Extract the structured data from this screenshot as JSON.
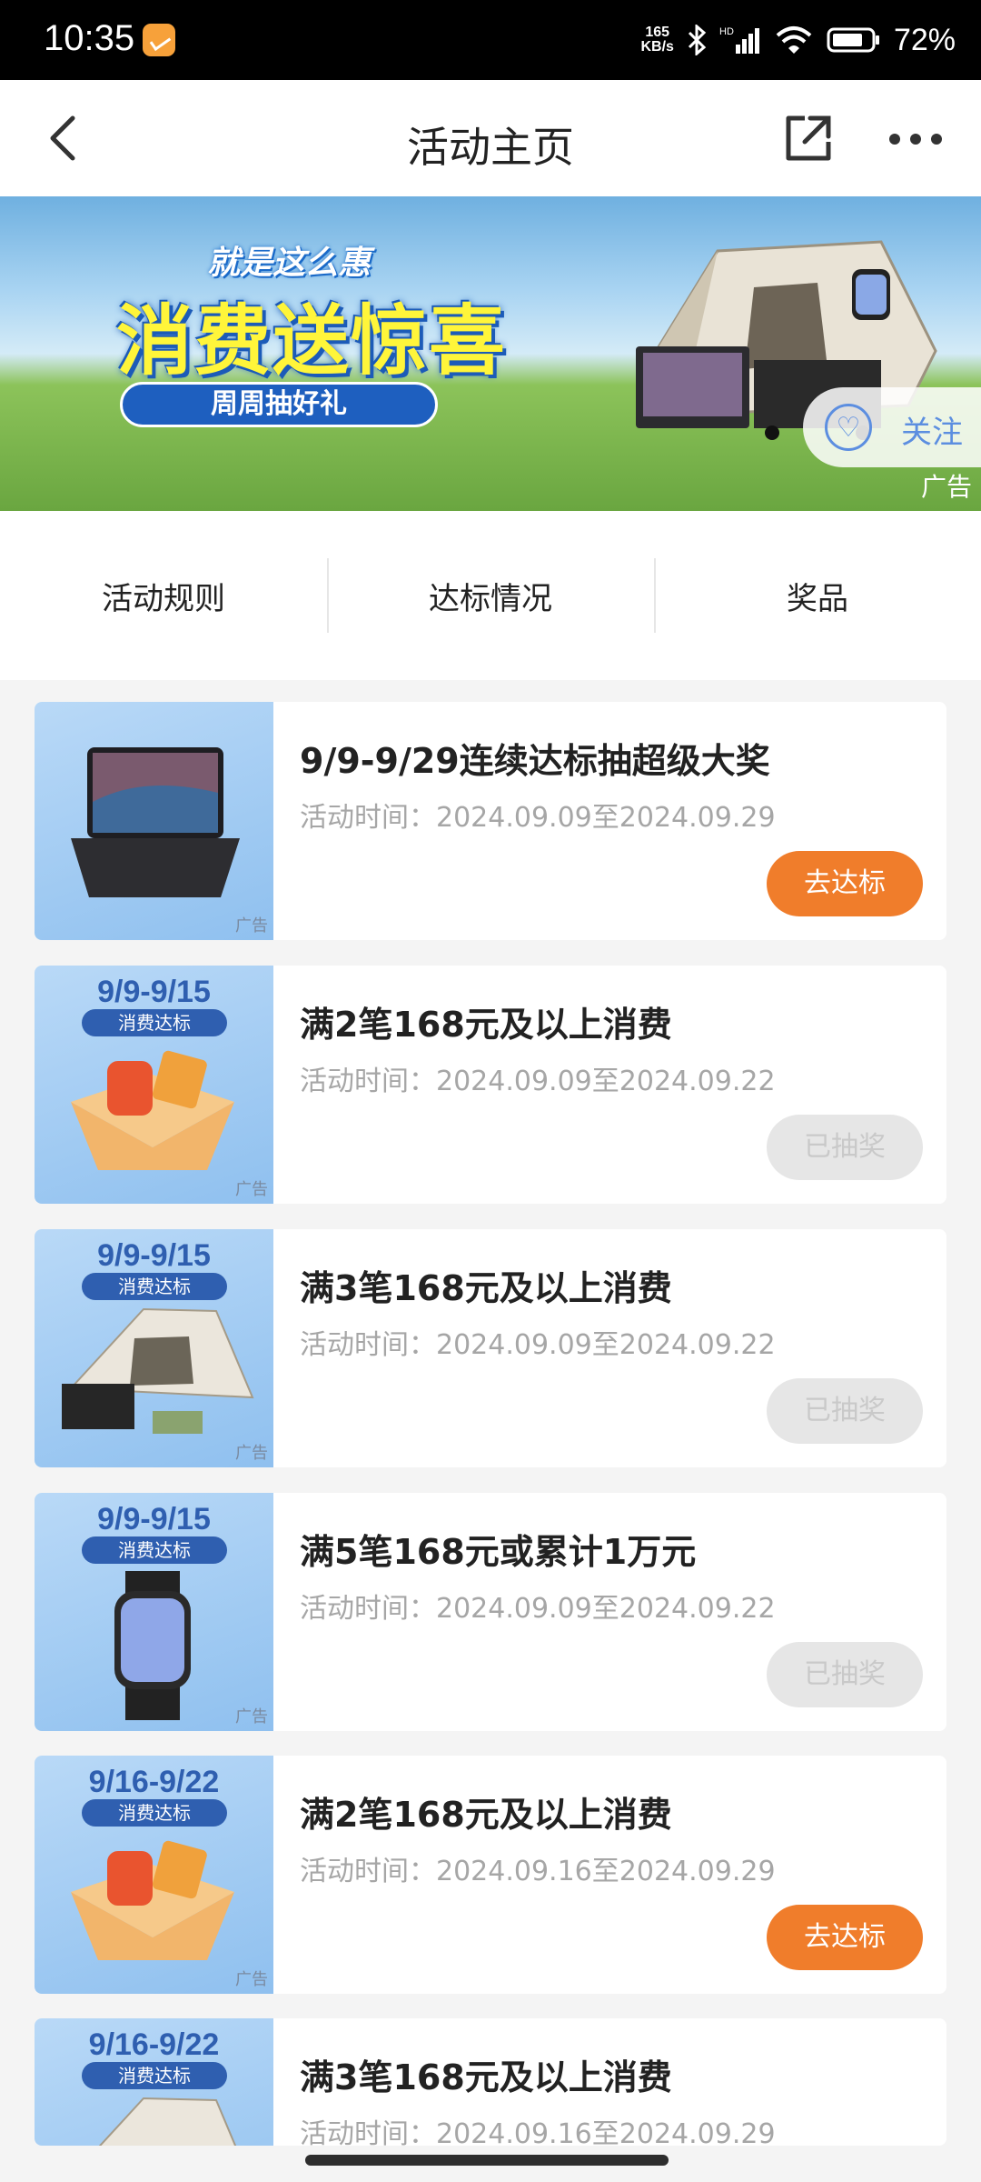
{
  "status_bar": {
    "time": "10:35",
    "net_speed_value": "165",
    "net_speed_unit": "KB/s",
    "hd": "HD",
    "battery": "72%"
  },
  "header": {
    "title": "活动主页"
  },
  "banner": {
    "brand": "就是这么惠",
    "headline": "消费送惊喜",
    "subline": "周周抽好礼",
    "follow_label": "关注",
    "ad_tag": "广告"
  },
  "tabs": [
    {
      "label": "活动规则"
    },
    {
      "label": "达标情况"
    },
    {
      "label": "奖品"
    }
  ],
  "activities": [
    {
      "thumb_date": "",
      "thumb_tag": "",
      "image": "laptop",
      "ad_tag": "广告",
      "title": "9/9-9/29连续达标抽超级大奖",
      "time": "活动时间：2024.09.09至2024.09.29",
      "button": "去达标",
      "state": "active"
    },
    {
      "thumb_date": "9/9-9/15",
      "thumb_tag": "消费达标",
      "image": "gift-box",
      "ad_tag": "广告",
      "title": "满2笔168元及以上消费",
      "time": "活动时间：2024.09.09至2024.09.22",
      "button": "已抽奖",
      "state": "done"
    },
    {
      "thumb_date": "9/9-9/15",
      "thumb_tag": "消费达标",
      "image": "tent",
      "ad_tag": "广告",
      "title": "满3笔168元及以上消费",
      "time": "活动时间：2024.09.09至2024.09.22",
      "button": "已抽奖",
      "state": "done"
    },
    {
      "thumb_date": "9/9-9/15",
      "thumb_tag": "消费达标",
      "image": "smartwatch",
      "ad_tag": "广告",
      "title": "满5笔168元或累计1万元",
      "time": "活动时间：2024.09.09至2024.09.22",
      "button": "已抽奖",
      "state": "done"
    },
    {
      "thumb_date": "9/16-9/22",
      "thumb_tag": "消费达标",
      "image": "gift-box",
      "ad_tag": "广告",
      "title": "满2笔168元及以上消费",
      "time": "活动时间：2024.09.16至2024.09.29",
      "button": "去达标",
      "state": "active"
    },
    {
      "thumb_date": "9/16-9/22",
      "thumb_tag": "消费达标",
      "image": "tent",
      "ad_tag": "广告",
      "title": "满3笔168元及以上消费",
      "time": "活动时间：2024.09.16至2024.09.29",
      "button": "",
      "state": "hidden"
    }
  ],
  "colors": {
    "accent_orange": "#f07d2b",
    "done_gray": "#e6e6e6",
    "thumb_blue": "#2f5fb0"
  }
}
